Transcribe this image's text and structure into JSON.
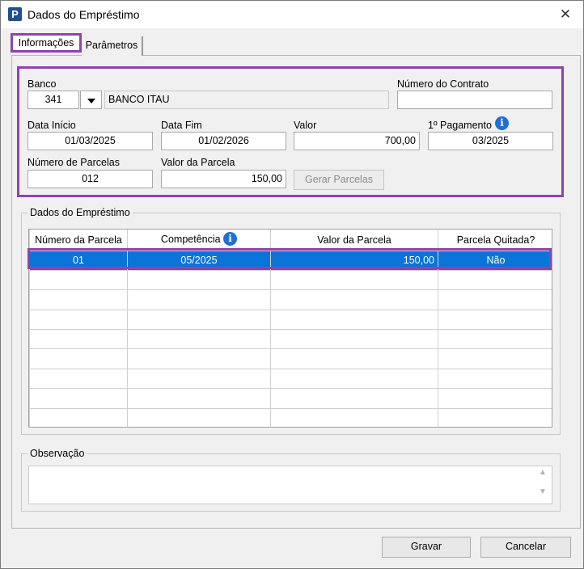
{
  "window": {
    "title": "Dados do Empréstimo",
    "app_icon_letter": "P"
  },
  "tabs": [
    {
      "label": "Informações",
      "active": true
    },
    {
      "label": "Parâmetros",
      "active": false
    }
  ],
  "form": {
    "banco_label": "Banco",
    "banco_code": "341",
    "banco_name": "BANCO ITAU",
    "contrato_label": "Número do Contrato",
    "contrato_value": "",
    "data_inicio_label": "Data Início",
    "data_inicio_value": "01/03/2025",
    "data_fim_label": "Data Fim",
    "data_fim_value": "01/02/2026",
    "valor_label": "Valor",
    "valor_value": "700,00",
    "primeiro_pagamento_label": "1º Pagamento",
    "primeiro_pagamento_value": "03/2025",
    "num_parcelas_label": "Número de Parcelas",
    "num_parcelas_value": "012",
    "valor_parcela_label": "Valor da Parcela",
    "valor_parcela_value": "150,00",
    "gerar_parcelas_label": "Gerar Parcelas"
  },
  "emprestimo_group": {
    "title": "Dados do Empréstimo",
    "columns": [
      "Número da Parcela",
      "Competência",
      "Valor da Parcela",
      "Parcela Quitada?"
    ],
    "rows": [
      [
        "01",
        "05/2025",
        "150,00",
        "Não"
      ]
    ],
    "empty_rows": 8
  },
  "observacao": {
    "title": "Observação",
    "value": ""
  },
  "footer": {
    "save_label": "Gravar",
    "cancel_label": "Cancelar"
  },
  "colors": {
    "highlight": "#8e44ad",
    "selection": "#0a74d8",
    "info_icon": "#1f6fd6"
  }
}
